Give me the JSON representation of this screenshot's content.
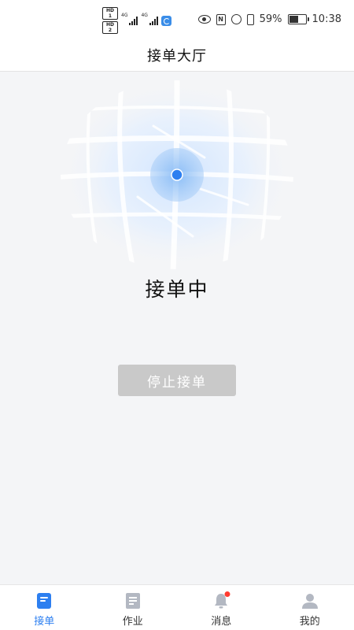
{
  "status_bar": {
    "hd_top": "HD 1",
    "hd_bottom": "HD 2",
    "net_1": "4G",
    "net_2": "4G",
    "nfc": "N",
    "battery_percent": "59%",
    "time": "10:38"
  },
  "header": {
    "title": "接单大厅"
  },
  "main": {
    "status_text": "接单中",
    "stop_button_label": "停止接单"
  },
  "tabs": [
    {
      "label": "接单",
      "icon": "order-icon",
      "active": true
    },
    {
      "label": "作业",
      "icon": "task-icon",
      "active": false
    },
    {
      "label": "消息",
      "icon": "bell-icon",
      "active": false,
      "badge": true
    },
    {
      "label": "我的",
      "icon": "user-icon",
      "active": false
    }
  ],
  "colors": {
    "accent": "#2d7ff0",
    "button_disabled": "#c9c9c9",
    "badge": "#ff3b30",
    "background": "#f4f5f7"
  }
}
